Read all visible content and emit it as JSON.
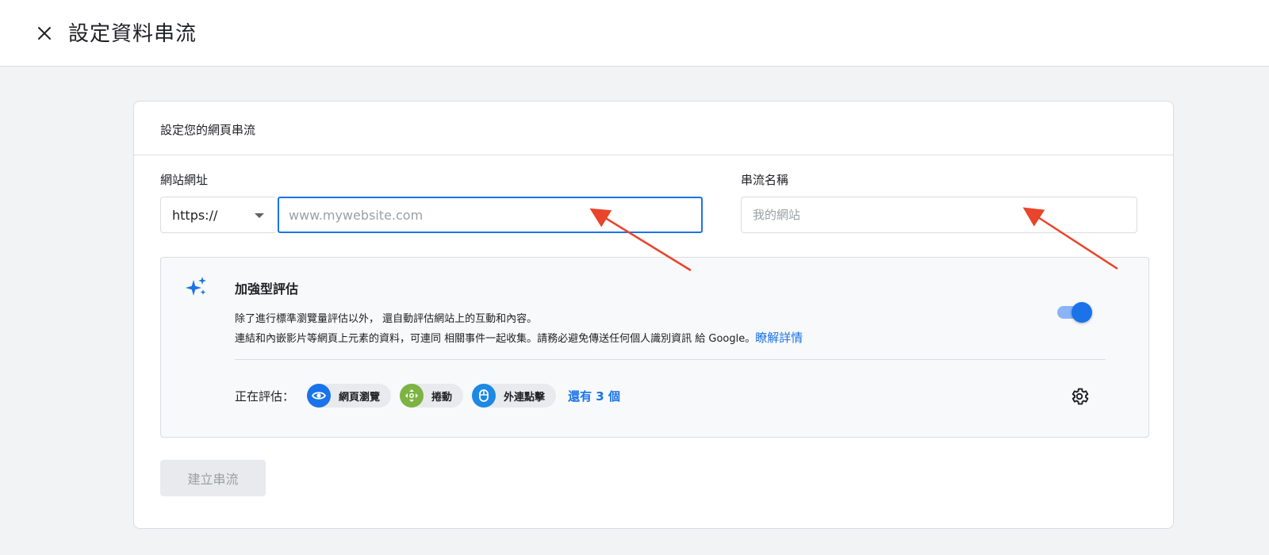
{
  "header": {
    "title": "設定資料串流",
    "close_icon": "close-icon"
  },
  "card": {
    "title": "設定您的網頁串流",
    "url_label": "網站網址",
    "protocol_value": "https://",
    "url_placeholder": "www.mywebsite.com",
    "url_value": "",
    "stream_name_label": "串流名稱",
    "stream_name_placeholder": "我的網站",
    "stream_name_value": ""
  },
  "enhanced": {
    "icon": "sparkle-icon",
    "title": "加強型評估",
    "desc_line1": "除了進行標準瀏覽量評估以外， 還自動評估網站上的互動和內容。",
    "desc_line2": "連結和內嵌影片等網頁上元素的資料，可連同 相關事件一起收集。請務必避免傳送任何個人識別資訊 給 Google。",
    "learn_more": "瞭解詳情",
    "toggle_on": true,
    "measuring_label": "正在評估：",
    "chips": [
      {
        "label": "網頁瀏覽",
        "icon": "eye-icon",
        "color": "#1a73e8"
      },
      {
        "label": "捲動",
        "icon": "scroll-icon",
        "color": "#7cb342"
      },
      {
        "label": "外連點擊",
        "icon": "mouse-icon",
        "color": "#1e88e5"
      }
    ],
    "more_link": "還有 3 個",
    "settings_icon": "gear-icon"
  },
  "actions": {
    "create_label": "建立串流"
  },
  "colors": {
    "accent": "#1a73e8",
    "annotation_arrow": "#e8452c"
  }
}
